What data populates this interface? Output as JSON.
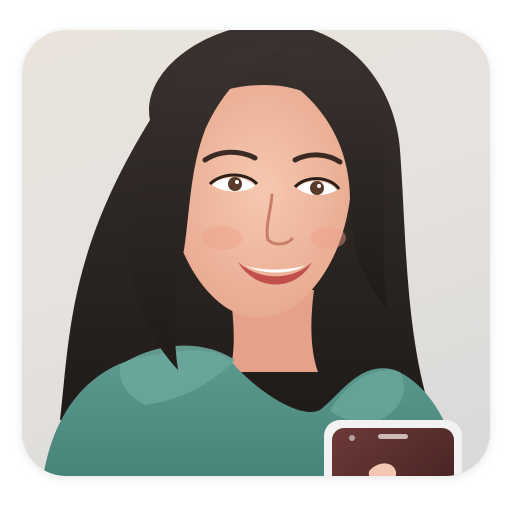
{
  "image": {
    "kind": "app-icon-illustration",
    "subject": "woman-with-phone",
    "colors": {
      "background": "#e6e2de",
      "hair": "#2b2522",
      "skin": "#f0bca3",
      "hoodie": "#4f8f84",
      "phone": "#5a2f2f"
    }
  }
}
